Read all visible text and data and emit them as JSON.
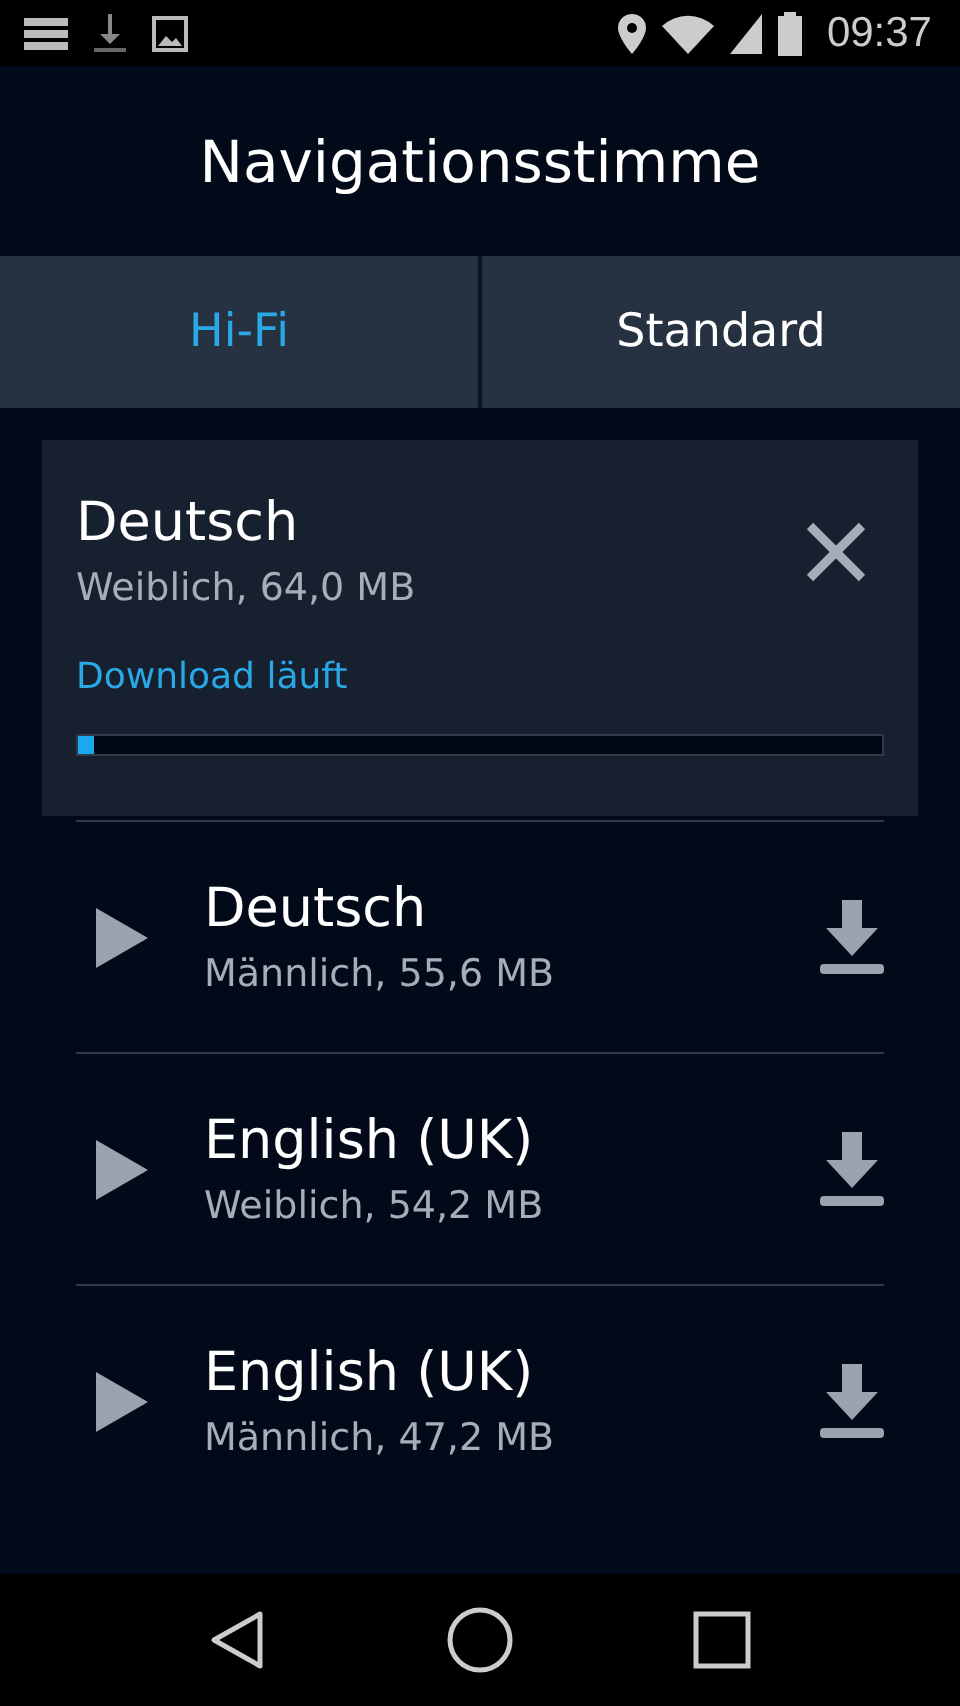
{
  "status_bar": {
    "time": "09:37"
  },
  "title": "Navigationsstimme",
  "tabs": [
    {
      "label": "Hi-Fi",
      "selected": true
    },
    {
      "label": "Standard",
      "selected": false
    }
  ],
  "active_download": {
    "name": "Deutsch",
    "details": "Weiblich, 64,0 MB",
    "status": "Download läuft",
    "level": 0.02
  },
  "voices": [
    {
      "name": "Deutsch",
      "details": "Männlich, 55,6 MB"
    },
    {
      "name": "English (UK)",
      "details": "Weiblich, 54,2 MB"
    },
    {
      "name": "English (UK)",
      "details": "Männlich, 47,2 MB"
    }
  ]
}
